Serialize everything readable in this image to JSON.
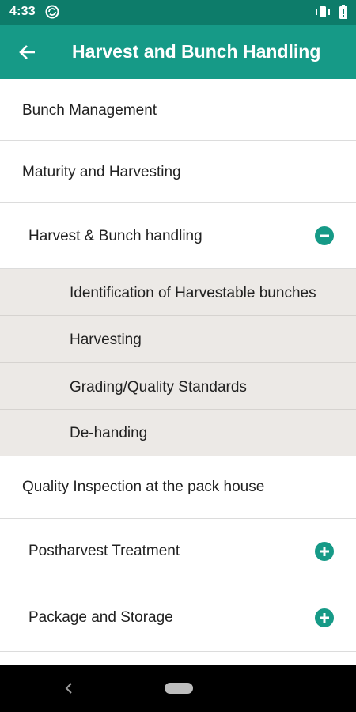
{
  "status_bar": {
    "time": "4:33",
    "left_icon": "sync-icon",
    "right_icons": [
      "vibrate-icon",
      "battery-icon"
    ]
  },
  "app_bar": {
    "title": "Harvest and Bunch Handling",
    "back_icon": "arrow-left-icon"
  },
  "menu": {
    "items": [
      {
        "label": "Bunch Management"
      },
      {
        "label": "Maturity and Harvesting"
      },
      {
        "label": "Harvest & Bunch handling",
        "expanded": true,
        "toggle_icon": "minus-circle-icon"
      },
      {
        "label": "Quality Inspection at the pack house"
      },
      {
        "label": "Postharvest Treatment",
        "expanded": false,
        "toggle_icon": "plus-circle-icon"
      },
      {
        "label": "Package and Storage",
        "expanded": false,
        "toggle_icon": "plus-circle-icon"
      }
    ],
    "subitems": [
      {
        "label": "Identification of Harvestable bunches"
      },
      {
        "label": "Harvesting"
      },
      {
        "label": "Grading/Quality Standards"
      },
      {
        "label": "De-handing"
      }
    ]
  },
  "colors": {
    "status_bar": "#0d7c6a",
    "app_bar": "#169a87",
    "accent": "#169a87",
    "sub_row_bg": "#ece9e6"
  }
}
